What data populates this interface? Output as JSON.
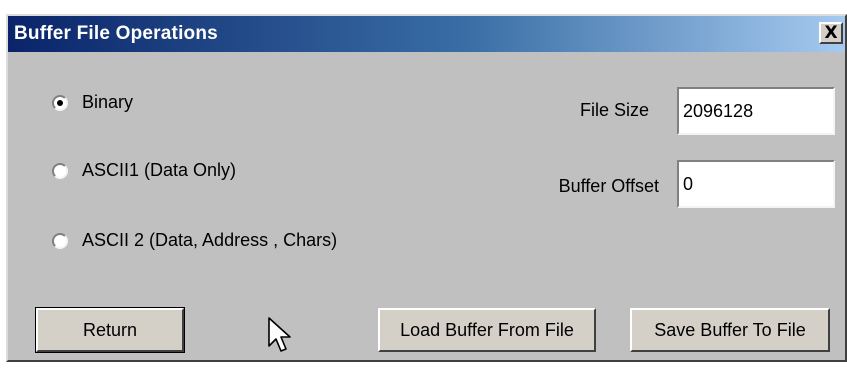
{
  "window": {
    "title": "Buffer File Operations",
    "close_glyph": "X"
  },
  "format_options": [
    {
      "label": "Binary",
      "selected": true
    },
    {
      "label": "ASCII1 (Data Only)",
      "selected": false
    },
    {
      "label": "ASCII 2 (Data, Address , Chars)",
      "selected": false
    }
  ],
  "fields": {
    "file_size": {
      "label": "File Size",
      "value": "2096128"
    },
    "buffer_offset": {
      "label": "Buffer Offset",
      "value": "0"
    }
  },
  "buttons": {
    "return": "Return",
    "load": "Load Buffer From File",
    "save": "Save Buffer To File"
  },
  "icons": {
    "cursor": "arrow-cursor-icon",
    "close": "close-icon"
  },
  "colors": {
    "title_start": "#0a246a",
    "title_end": "#a6caf0",
    "face": "#c0c0c0"
  }
}
